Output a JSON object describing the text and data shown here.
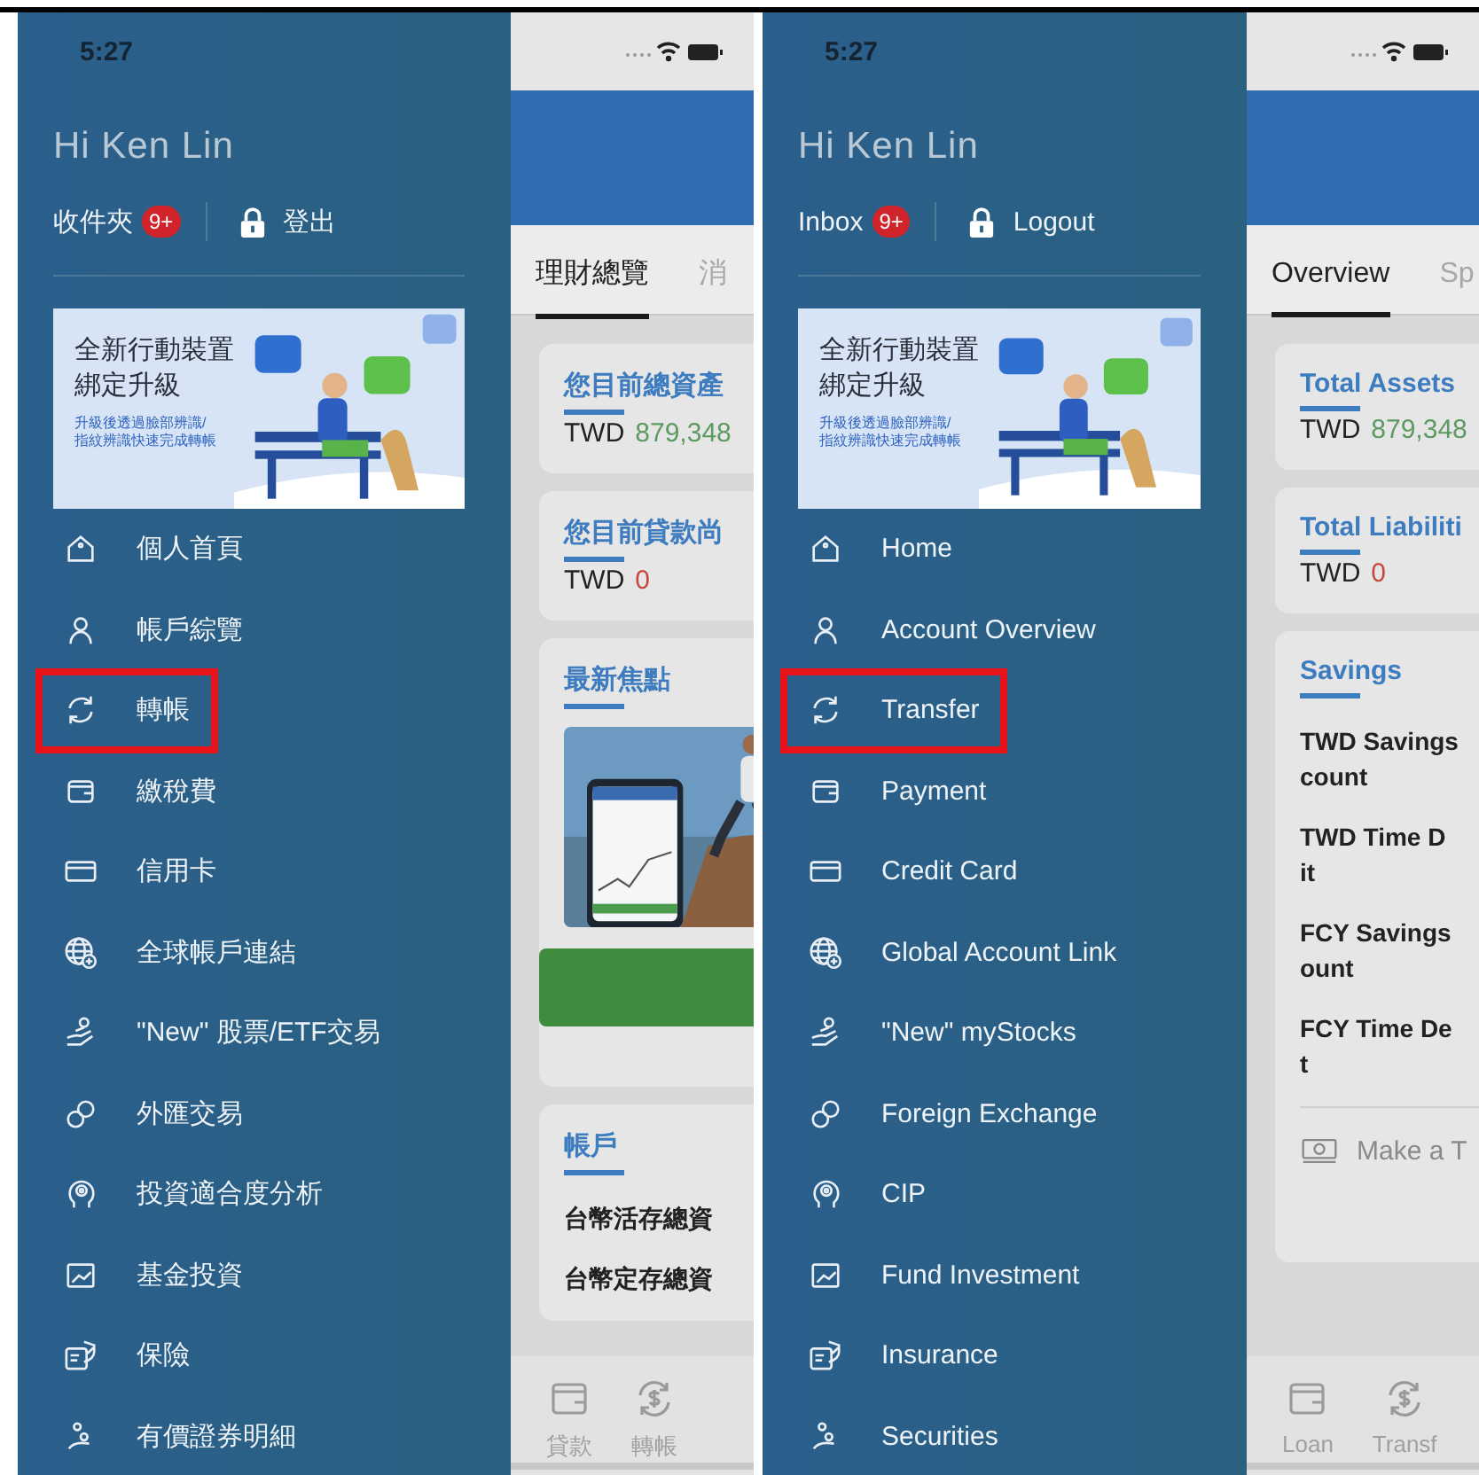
{
  "phones": [
    {
      "time": "5:27",
      "greeting": "Hi Ken Lin",
      "inbox": {
        "label": "收件夾",
        "badge": "9+"
      },
      "logout": "登出",
      "banner": {
        "headline": [
          "全新行動裝置",
          "綁定升級"
        ],
        "subline": [
          "升級後透過臉部辨識/",
          "指紋辨識快速完成轉帳"
        ]
      },
      "menu": [
        {
          "kind": "home",
          "label": "個人首頁",
          "highlighted": false
        },
        {
          "kind": "user",
          "label": "帳戶綜覽",
          "highlighted": false
        },
        {
          "kind": "transfer",
          "label": "轉帳",
          "highlighted": true
        },
        {
          "kind": "wallet",
          "label": "繳稅費",
          "highlighted": false
        },
        {
          "kind": "card",
          "label": "信用卡",
          "highlighted": false
        },
        {
          "kind": "globe",
          "label": "全球帳戶連結",
          "highlighted": false
        },
        {
          "kind": "stocks",
          "label": "\"New\" 股票/ETF交易",
          "highlighted": false
        },
        {
          "kind": "exchange",
          "label": "外匯交易",
          "highlighted": false
        },
        {
          "kind": "cip",
          "label": "投資適合度分析",
          "highlighted": false
        },
        {
          "kind": "fund",
          "label": "基金投資",
          "highlighted": false
        },
        {
          "kind": "insurance",
          "label": "保險",
          "highlighted": false
        },
        {
          "kind": "securities",
          "label": "有價證券明細",
          "highlighted": false
        }
      ],
      "content": {
        "tabs": [
          {
            "label": "理財總覽",
            "selected": true
          },
          {
            "label": "消",
            "selected": false
          }
        ],
        "cards": [
          {
            "kind": "amount",
            "title": "您目前總資產",
            "currency": "TWD",
            "value": "879,348",
            "color": "#5c9a62"
          },
          {
            "kind": "amount",
            "title": "您目前貸款尚",
            "currency": "TWD",
            "value": "0",
            "color": "#c9463f"
          },
          {
            "kind": "promo",
            "title": "最新焦點"
          },
          {
            "kind": "list",
            "title": "帳戶",
            "rows": [
              [
                "台幣活存總資"
              ],
              [
                "台幣定存總資"
              ]
            ]
          }
        ],
        "bottom_nav": [
          {
            "kind": "wallet",
            "label": "貸款"
          },
          {
            "kind": "dollar",
            "label": "轉帳"
          }
        ]
      }
    },
    {
      "time": "5:27",
      "greeting": "Hi Ken Lin",
      "inbox": {
        "label": "Inbox",
        "badge": "9+"
      },
      "logout": "Logout",
      "banner": {
        "headline": [
          "全新行動裝置",
          "綁定升級"
        ],
        "subline": [
          "升級後透過臉部辨識/",
          "指紋辨識快速完成轉帳"
        ]
      },
      "menu": [
        {
          "kind": "home",
          "label": "Home",
          "highlighted": false
        },
        {
          "kind": "user",
          "label": "Account Overview",
          "highlighted": false
        },
        {
          "kind": "transfer",
          "label": "Transfer",
          "highlighted": true
        },
        {
          "kind": "wallet",
          "label": "Payment",
          "highlighted": false
        },
        {
          "kind": "card",
          "label": "Credit Card",
          "highlighted": false
        },
        {
          "kind": "globe",
          "label": "Global Account Link",
          "highlighted": false
        },
        {
          "kind": "stocks",
          "label": "\"New\" myStocks",
          "highlighted": false
        },
        {
          "kind": "exchange",
          "label": "Foreign Exchange",
          "highlighted": false
        },
        {
          "kind": "cip",
          "label": "CIP",
          "highlighted": false
        },
        {
          "kind": "fund",
          "label": "Fund Investment",
          "highlighted": false
        },
        {
          "kind": "insurance",
          "label": "Insurance",
          "highlighted": false
        },
        {
          "kind": "securities",
          "label": "Securities",
          "highlighted": false
        }
      ],
      "content": {
        "tabs": [
          {
            "label": "Overview",
            "selected": true
          },
          {
            "label": "Sp",
            "selected": false
          }
        ],
        "cards": [
          {
            "kind": "amount",
            "title": "Total Assets",
            "currency": "TWD",
            "value": "879,348",
            "color": "#5c9a62"
          },
          {
            "kind": "amount",
            "title": "Total Liabiliti",
            "currency": "TWD",
            "value": "0",
            "color": "#c9463f"
          },
          {
            "kind": "list",
            "title": "Savings",
            "rows": [
              [
                "TWD Savings",
                "count"
              ],
              [
                "TWD Time D",
                "it"
              ],
              [
                "FCY Savings",
                "ount"
              ],
              [
                "FCY Time De",
                "t"
              ]
            ],
            "action": "Make a T"
          }
        ],
        "bottom_nav": [
          {
            "kind": "wallet",
            "label": "Loan"
          },
          {
            "kind": "dollar",
            "label": "Transf"
          }
        ]
      }
    }
  ]
}
